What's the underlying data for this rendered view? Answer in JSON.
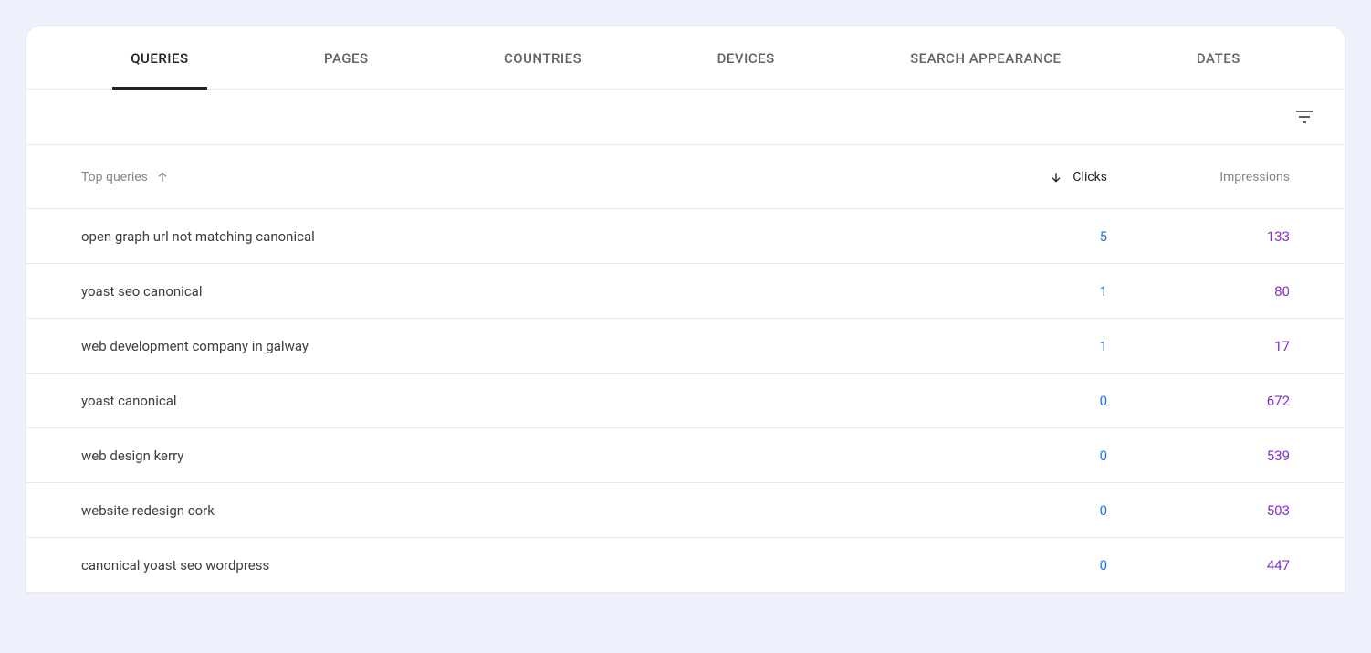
{
  "tabs": [
    {
      "label": "QUERIES",
      "active": true
    },
    {
      "label": "PAGES",
      "active": false
    },
    {
      "label": "COUNTRIES",
      "active": false
    },
    {
      "label": "DEVICES",
      "active": false
    },
    {
      "label": "SEARCH APPEARANCE",
      "active": false
    },
    {
      "label": "DATES",
      "active": false
    }
  ],
  "columns": {
    "query_header": "Top queries",
    "clicks_header": "Clicks",
    "impressions_header": "Impressions"
  },
  "rows": [
    {
      "query": "open graph url not matching canonical",
      "clicks": "5",
      "impressions": "133"
    },
    {
      "query": "yoast seo canonical",
      "clicks": "1",
      "impressions": "80"
    },
    {
      "query": "web development company in galway",
      "clicks": "1",
      "impressions": "17"
    },
    {
      "query": "yoast canonical",
      "clicks": "0",
      "impressions": "672"
    },
    {
      "query": "web design kerry",
      "clicks": "0",
      "impressions": "539"
    },
    {
      "query": "website redesign cork",
      "clicks": "0",
      "impressions": "503"
    },
    {
      "query": "canonical yoast seo wordpress",
      "clicks": "0",
      "impressions": "447"
    }
  ]
}
